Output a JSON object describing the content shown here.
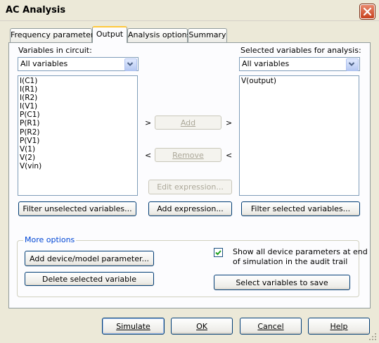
{
  "window": {
    "title": "AC Analysis"
  },
  "tabs": [
    {
      "label": "Frequency parameters"
    },
    {
      "label": "Output"
    },
    {
      "label": "Analysis options"
    },
    {
      "label": "Summary"
    }
  ],
  "left_panel": {
    "heading": "Variables in circuit:",
    "filter_selected": "All variables",
    "items": [
      "I(C1)",
      "I(R1)",
      "I(R2)",
      "I(V1)",
      "P(C1)",
      "P(R1)",
      "P(R2)",
      "P(V1)",
      "V(1)",
      "V(2)",
      "V(vin)"
    ],
    "filter_button": "Filter unselected variables..."
  },
  "right_panel": {
    "heading": "Selected variables for analysis:",
    "filter_selected": "All variables",
    "items": [
      "V(output)"
    ],
    "filter_button": "Filter selected variables..."
  },
  "middle": {
    "add_button": "Add",
    "remove_button": "Remove",
    "arrow_right": ">",
    "arrow_left": "<",
    "edit_expression_button": "Edit expression...",
    "add_expression_button": "Add expression..."
  },
  "more_options": {
    "legend": "More options",
    "add_param_button": "Add device/model parameter...",
    "delete_var_button": "Delete selected variable",
    "show_all_checked": true,
    "show_all_label_line1": "Show all device parameters at end",
    "show_all_label_line2": "of simulation in the audit trail",
    "select_vars_button": "Select variables to save"
  },
  "footer": {
    "simulate": "Simulate",
    "ok": "OK",
    "cancel": "Cancel",
    "help": "Help"
  },
  "colors": {
    "accent": "#0046d5",
    "tab_highlight": "#ffc83c",
    "background": "#ece9d8"
  },
  "icons": [
    "close-icon",
    "chevron-down-icon",
    "checkmark-icon"
  ]
}
